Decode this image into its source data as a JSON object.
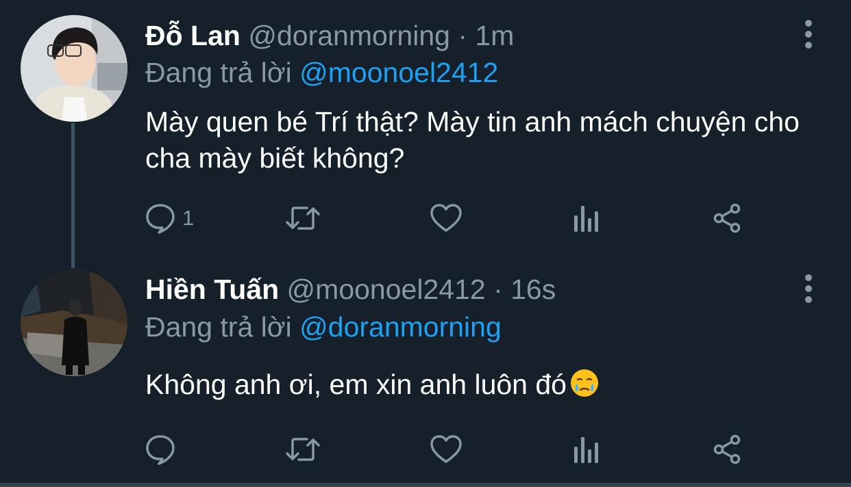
{
  "colors": {
    "background": "#15202b",
    "text_primary": "#ffffff",
    "text_secondary": "#8899a6",
    "link": "#1da1f2",
    "thread_line": "#3d5466"
  },
  "tweets": [
    {
      "display_name": "Đỗ Lan",
      "handle": "@doranmorning",
      "separator": "·",
      "time": "1m",
      "reply_prefix": "Đang trả lời",
      "reply_to": "@moonoel2412",
      "text": "Mày quen bé Trí thật? Mày tin anh mách chuyện cho cha mày biết không?",
      "emoji": "",
      "reply_count": "1",
      "icons": [
        "more-vertical-icon",
        "reply-icon",
        "retweet-icon",
        "like-icon",
        "analytics-icon",
        "share-icon"
      ]
    },
    {
      "display_name": "Hiền Tuấn",
      "handle": "@moonoel2412",
      "separator": "·",
      "time": "16s",
      "reply_prefix": "Đang trả lời",
      "reply_to": "@doranmorning",
      "text": "Không anh ơi, em xin anh luôn đó",
      "emoji": "face-holding-back-tears",
      "reply_count": "",
      "icons": [
        "more-vertical-icon",
        "reply-icon",
        "retweet-icon",
        "like-icon",
        "analytics-icon",
        "share-icon"
      ]
    }
  ]
}
